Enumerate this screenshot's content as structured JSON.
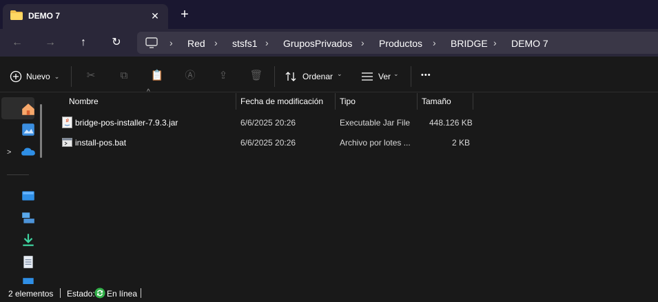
{
  "window": {
    "tab_title": "DEMO 7",
    "tab_close": "✕",
    "new_tab": "+"
  },
  "nav": {
    "back": "←",
    "forward": "→",
    "up": "↑",
    "refresh": "↻"
  },
  "breadcrumb": {
    "items": [
      "Red",
      "stsfs1",
      "GruposPrivados",
      "Productos",
      "BRIDGE",
      "DEMO 7"
    ],
    "separator": "›"
  },
  "toolbar": {
    "new_label": "Nuevo",
    "sort_label": "Ordenar",
    "view_label": "Ver",
    "more_label": "•••"
  },
  "columns": {
    "name": "Nombre",
    "modified": "Fecha de modificación",
    "type": "Tipo",
    "size": "Tamaño"
  },
  "files": [
    {
      "name": "bridge-pos-installer-7.9.3.jar",
      "modified": "6/6/2025 20:26",
      "type": "Executable Jar File",
      "size": "448.126 KB",
      "icon": "java-jar-icon"
    },
    {
      "name": "install-pos.bat",
      "modified": "6/6/2025 20:26",
      "type": "Archivo por lotes ...",
      "size": "2 KB",
      "icon": "batch-file-icon"
    }
  ],
  "status": {
    "count": "2 elementos",
    "state_label": "Estado:",
    "state_value": "En línea"
  },
  "colors": {
    "titlebar": "#1a1730",
    "addressbar": "#2a2739",
    "background": "#191919",
    "folder": "#f2c14e",
    "accent": "#4cc2ff"
  }
}
